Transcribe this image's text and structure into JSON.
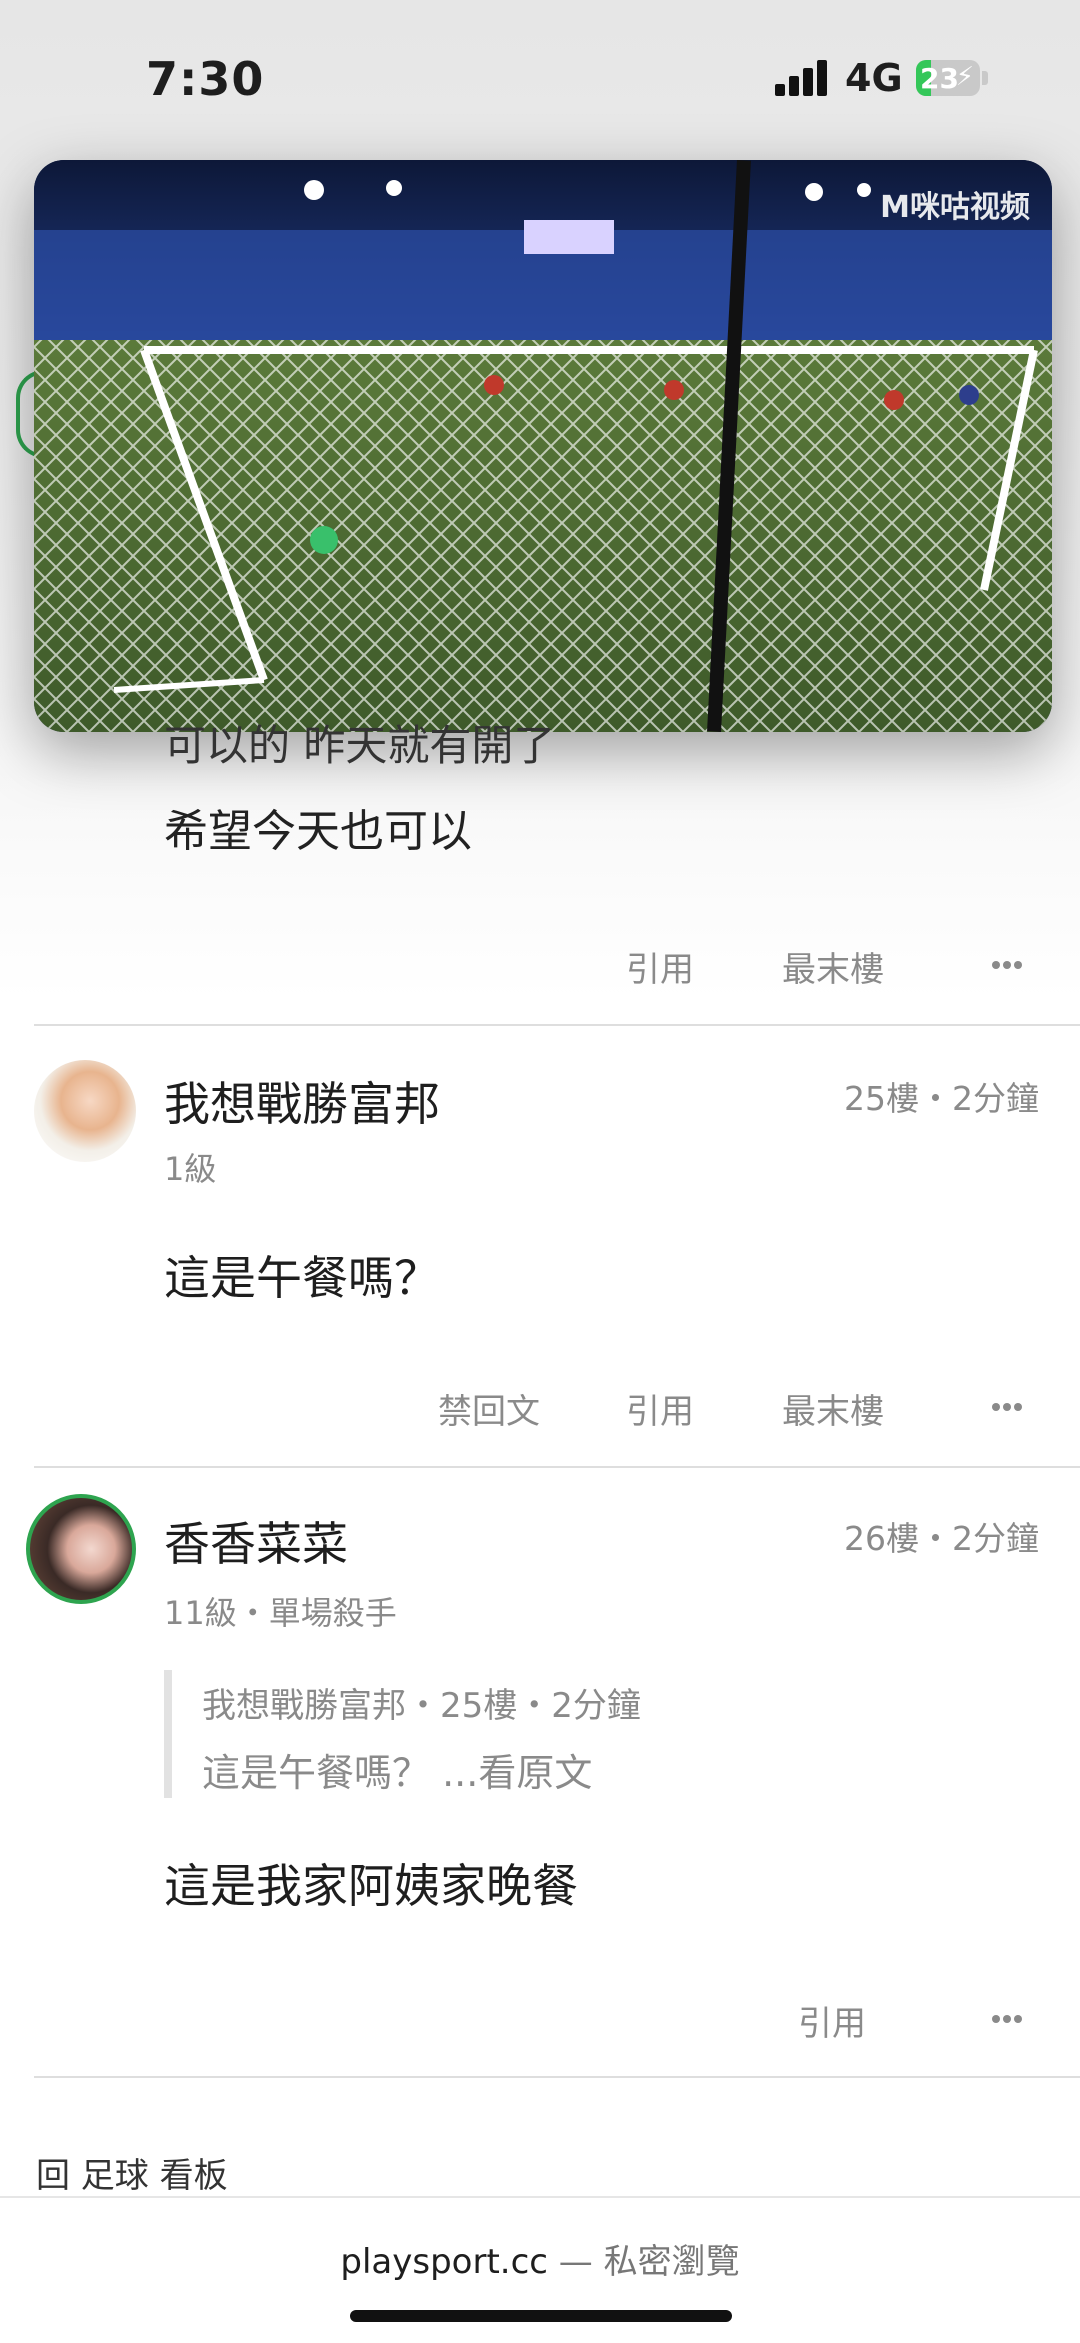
{
  "status_bar": {
    "time": "7:30",
    "network": "4G",
    "battery": "23",
    "battery_level": 0.23
  },
  "video_overlay": {
    "logo": "M咪咕视频"
  },
  "post_24": {
    "line1": "可以的 昨天就有開了",
    "line2": "希望今天也可以",
    "actions": [
      "引用",
      "最末樓"
    ]
  },
  "post_25": {
    "username": "我想戰勝富邦",
    "meta": "25樓・2分鐘",
    "level": "1級",
    "content": "這是午餐嗎？",
    "actions": [
      "禁回文",
      "引用",
      "最末樓"
    ]
  },
  "post_26": {
    "username": "香香菜菜",
    "meta": "26樓・2分鐘",
    "level": "11級・單場殺手",
    "quote_header": "我想戰勝富邦・25樓・2分鐘",
    "quote_text": "這是午餐嗎？ ...看原文",
    "content": "這是我家阿姨家晚餐",
    "actions": [
      "引用"
    ]
  },
  "footer": {
    "board_link": "回 足球 看板",
    "url": "playsport.cc",
    "url_sep": " — ",
    "mode": "私密瀏覽"
  },
  "colors": {
    "accent_green": "#2ea44f",
    "battery_green": "#34c759",
    "muted_text": "#8a8a8a"
  }
}
